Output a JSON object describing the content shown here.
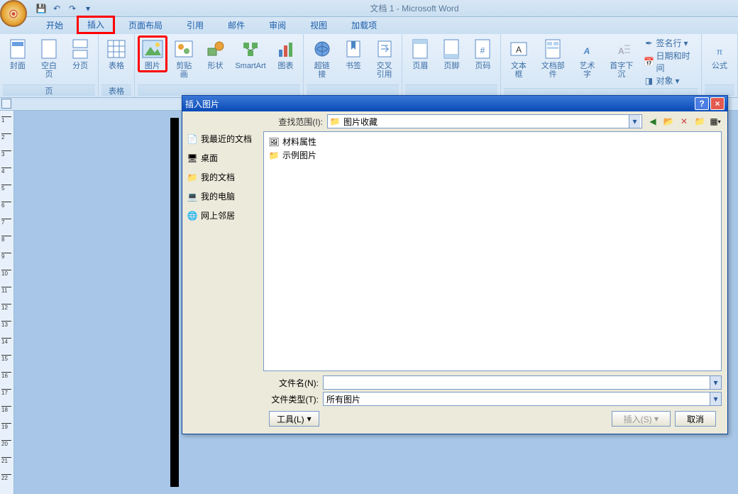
{
  "app": {
    "title": "文档 1 - Microsoft Word"
  },
  "qat": {
    "save": "💾",
    "undo": "↶",
    "redo": "↷"
  },
  "tabs": {
    "start": "开始",
    "insert": "插入",
    "layout": "页面布局",
    "ref": "引用",
    "mail": "邮件",
    "review": "审阅",
    "view": "视图",
    "addins": "加载项"
  },
  "ribbon": {
    "pages": {
      "cover": "封面",
      "blank": "空白页",
      "break": "分页",
      "group": "页"
    },
    "tables": {
      "table": "表格",
      "group": "表格"
    },
    "illus": {
      "picture": "图片",
      "clipart": "剪贴画",
      "shapes": "形状",
      "smartart": "SmartArt",
      "chart": "图表"
    },
    "links": {
      "hyperlink": "超链接",
      "bookmark": "书签",
      "crossref": "交叉\n引用"
    },
    "hf": {
      "header": "页眉",
      "footer": "页脚",
      "number": "页码"
    },
    "text": {
      "textbox": "文本框",
      "parts": "文档部件",
      "wordart": "艺术字",
      "dropcap": "首字下沉"
    },
    "text2": {
      "sigline": "签名行",
      "datetime": "日期和时间",
      "object": "对象"
    },
    "symbols": {
      "equation": "公式"
    }
  },
  "dialog": {
    "title": "插入图片",
    "lookin_label": "查找范围(I):",
    "lookin_value": "图片收藏",
    "places": {
      "recent": "我最近的文档",
      "desktop": "桌面",
      "mydocs": "我的文档",
      "mycomp": "我的电脑",
      "network": "网上邻居"
    },
    "files": {
      "f1": "材料属性",
      "f2": "示例图片"
    },
    "filename_label": "文件名(N):",
    "filename_value": "",
    "filetype_label": "文件类型(T):",
    "filetype_value": "所有图片",
    "tools": "工具(L)",
    "insert_btn": "插入(S)",
    "cancel_btn": "取消"
  },
  "ruler_ticks": [
    1,
    2,
    3,
    4,
    5,
    6,
    7,
    8,
    9,
    10,
    11,
    12,
    13,
    14,
    15,
    16,
    17,
    18,
    19,
    20,
    21,
    22
  ]
}
